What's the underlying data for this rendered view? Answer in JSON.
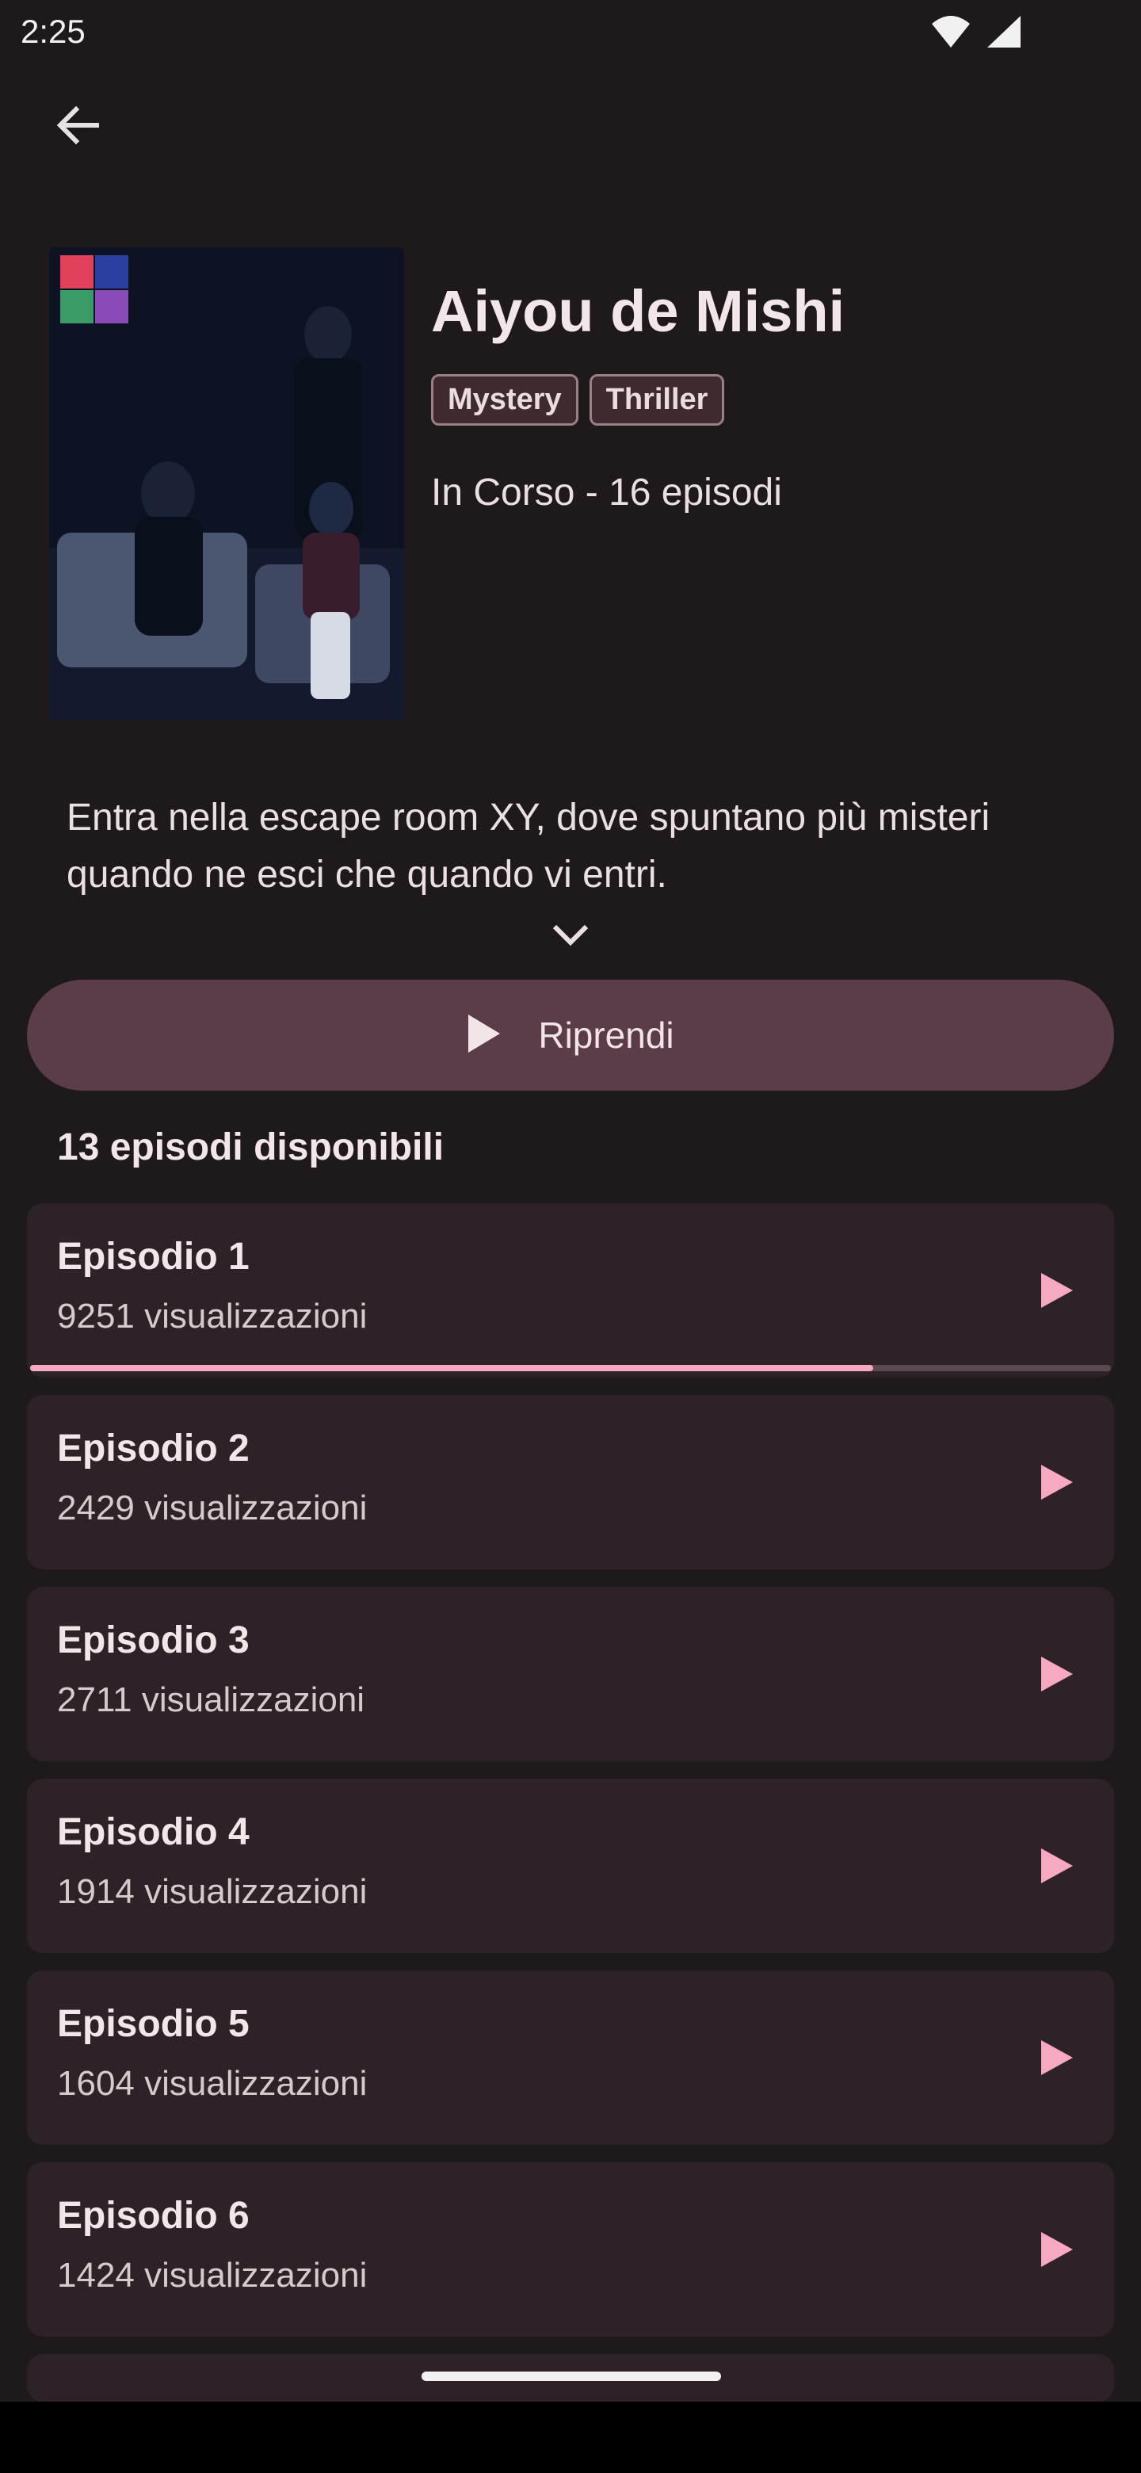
{
  "status_bar": {
    "time": "2:25",
    "icons": [
      "wifi-icon",
      "signal-icon"
    ]
  },
  "header": {
    "back_icon": "arrow-left-icon"
  },
  "show": {
    "title": "Aiyou de Mishi",
    "genres": [
      "Mystery",
      "Thriller"
    ],
    "status": "In Corso - 16 episodi",
    "description": "Entra nella escape room XY, dove spuntano più misteri quando ne esci che quando vi entri."
  },
  "resume_button": {
    "label": "Riprendi",
    "icon": "play-icon"
  },
  "episodes_section": {
    "title": "13 episodi disponibili"
  },
  "episodes": [
    {
      "title": "Episodio 1",
      "views": "9251 visualizzazioni",
      "progress": 0.78
    },
    {
      "title": "Episodio 2",
      "views": "2429 visualizzazioni"
    },
    {
      "title": "Episodio 3",
      "views": "2711 visualizzazioni"
    },
    {
      "title": "Episodio 4",
      "views": "1914 visualizzazioni"
    },
    {
      "title": "Episodio 5",
      "views": "1604 visualizzazioni"
    },
    {
      "title": "Episodio 6",
      "views": "1424 visualizzazioni"
    }
  ],
  "colors": {
    "background": "#1e191b",
    "card": "#2c2227",
    "accent": "#f6a9c0",
    "resume_button": "#5a3d48"
  }
}
